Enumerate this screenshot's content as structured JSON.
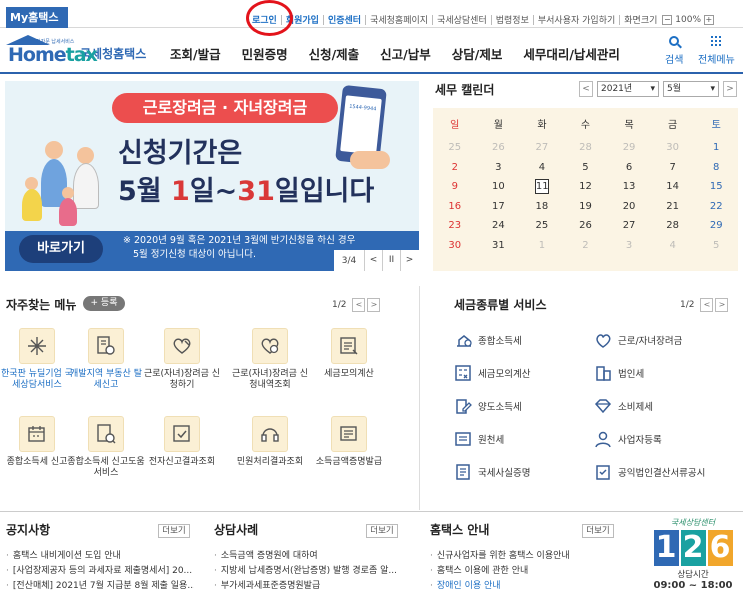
{
  "topbar": {
    "my_tab": "My홈택스",
    "links": [
      "로그인",
      "회원가입",
      "인증센터",
      "국세청홈페이지",
      "국세상담센터",
      "법령정보",
      "부서사용자 가입하기",
      "화면크기"
    ],
    "zoom_minus": "−",
    "zoom_value": "100%",
    "zoom_plus": "+"
  },
  "header": {
    "logo_small": "전자문 납세서비스",
    "logo_home": "Home",
    "logo_tax": "tax",
    "logo_korean": "국세청홈택스",
    "nav": [
      "조회/발급",
      "민원증명",
      "신청/제출",
      "신고/납부",
      "상담/제보",
      "세무대리/납세관리"
    ],
    "search_label": "검색",
    "all_menu_label": "전체메뉴"
  },
  "banner": {
    "pill": "근로장려금 · 자녀장려금",
    "line1": "신청기간은",
    "line2_a": "5월 ",
    "line2_b": "1",
    "line2_c": "일~",
    "line2_d": "31",
    "line2_e": "일입니다",
    "phone_number": "1544-9944",
    "button": "바로가기",
    "note_line1": "※ 2020년 9월 혹은 2021년 3월에 반기신청을 하신 경우",
    "note_line2": "5월 정기신청 대상이 아닙니다.",
    "pager": "3/4",
    "prev": "<",
    "pause": "II",
    "next": ">"
  },
  "calendar": {
    "title": "세무 캘린더",
    "year": "2021년",
    "month": "5월",
    "prev": "<",
    "next": ">",
    "weekdays": [
      "일",
      "월",
      "화",
      "수",
      "목",
      "금",
      "토"
    ],
    "days": [
      {
        "d": "25",
        "dim": true
      },
      {
        "d": "26",
        "dim": true
      },
      {
        "d": "27",
        "dim": true
      },
      {
        "d": "28",
        "dim": true
      },
      {
        "d": "29",
        "dim": true
      },
      {
        "d": "30",
        "dim": true
      },
      {
        "d": "1"
      },
      {
        "d": "2"
      },
      {
        "d": "3"
      },
      {
        "d": "4"
      },
      {
        "d": "5"
      },
      {
        "d": "6"
      },
      {
        "d": "7"
      },
      {
        "d": "8"
      },
      {
        "d": "9"
      },
      {
        "d": "10"
      },
      {
        "d": "11",
        "today": true
      },
      {
        "d": "12"
      },
      {
        "d": "13"
      },
      {
        "d": "14"
      },
      {
        "d": "15"
      },
      {
        "d": "16"
      },
      {
        "d": "17"
      },
      {
        "d": "18"
      },
      {
        "d": "19"
      },
      {
        "d": "20"
      },
      {
        "d": "21"
      },
      {
        "d": "22"
      },
      {
        "d": "23"
      },
      {
        "d": "24"
      },
      {
        "d": "25"
      },
      {
        "d": "26"
      },
      {
        "d": "27"
      },
      {
        "d": "28"
      },
      {
        "d": "29"
      },
      {
        "d": "30"
      },
      {
        "d": "31"
      },
      {
        "d": "1",
        "dim": true
      },
      {
        "d": "2",
        "dim": true
      },
      {
        "d": "3",
        "dim": true
      },
      {
        "d": "4",
        "dim": true
      },
      {
        "d": "5",
        "dim": true
      }
    ]
  },
  "favorites": {
    "title": "자주찾는 메뉴",
    "add_button": "+ 등록",
    "pager": "1/2",
    "prev": "<",
    "next": ">",
    "items": [
      {
        "label": "한국판 뉴딜기업 국세상담서비스",
        "blue": true
      },
      {
        "label": "개발지역 부동산 탈세신고",
        "blue": true
      },
      {
        "label": "근로(자녀)장려금 신청하기"
      },
      {
        "label": "근로(자녀)장려금 신청내역조회"
      },
      {
        "label": "세금모의계산"
      },
      {
        "label": "종합소득세 신고"
      },
      {
        "label": "종합소득세 신고도움 서비스"
      },
      {
        "label": "전자신고결과조회"
      },
      {
        "label": "민원처리결과조회"
      },
      {
        "label": "소득금액증명발급"
      }
    ]
  },
  "tax_services": {
    "title": "세금종류별 서비스",
    "pager": "1/2",
    "prev": "<",
    "next": ">",
    "items": [
      "종합소득세",
      "근로/자녀장려금",
      "세금모의계산",
      "법인세",
      "양도소득세",
      "소비제세",
      "원천세",
      "사업자등록",
      "국세사실증명",
      "공익법인결산서류공시"
    ]
  },
  "notice": {
    "title": "공지사항",
    "more": "더보기",
    "items": [
      "홈택스 내비게이션 도입 안내",
      "[사업장제공자 등의 과세자료 제출명세서] 20...",
      "[전산매체] 2021년 7월 지급분 8월 제출 일용..."
    ]
  },
  "consult": {
    "title": "상담사례",
    "more": "더보기",
    "items": [
      "소득금액 증명원에 대하여",
      "지방세 납세증명서(완납증명) 발행 경로좀 알...",
      "부가세과세표준증명원발급"
    ]
  },
  "guide": {
    "title": "홈택스 안내",
    "more": "더보기",
    "items": [
      "신규사업자를 위한 홈택스 이용안내",
      "홈택스 이용에 관한 안내",
      "장애인 이용 안내"
    ]
  },
  "center": {
    "caption": "국세상담센터",
    "digits": [
      "1",
      "2",
      "6"
    ],
    "hours_label": "상담시간",
    "hours": "09:00 ~ 18:00"
  },
  "colors": {
    "brand_blue": "#2f69b4",
    "login_highlight": "#e3131b",
    "banner_pill": "#ec4e4e",
    "calendar_bg": "#fbf4e4"
  }
}
